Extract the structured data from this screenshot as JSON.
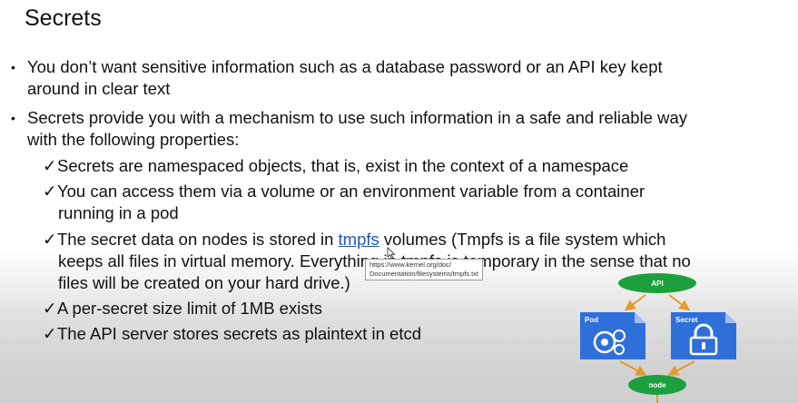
{
  "slide": {
    "title": "Secrets",
    "bullets": [
      {
        "dot": "•",
        "lines": [
          "You don’t want sensitive information such as a database password or an API key kept",
          "around in clear text"
        ]
      },
      {
        "dot": "•",
        "lines": [
          "Secrets provide you with a mechanism to use such information in a safe and reliable way",
          "with the following properties:"
        ]
      }
    ],
    "checks": {
      "mark": "✓",
      "items": [
        {
          "line1": "Secrets are namespaced objects, that is, exist in the context of a namespace"
        },
        {
          "line1": "You can access them via a volume or an environment variable from a container",
          "line2": "running in a pod"
        },
        {
          "line1_pre": "The secret data on nodes is stored in ",
          "link": "tmpfs",
          "line1_post": " volumes (Tmpfs is a file system which",
          "line2": "keeps all files in virtual memory. Everything in tmpfs is temporary in the sense that no",
          "line3": "files will be created on your hard drive.)"
        },
        {
          "line1": "A per-secret size limit of 1MB exists"
        },
        {
          "line1": "The API server stores secrets as plaintext in etcd"
        }
      ]
    },
    "tooltip": {
      "line1": "https://www.kernel.org/doc/",
      "line2": "Documentation/filesystems/tmpfs.txt"
    },
    "diagram": {
      "api_label": "API",
      "pod_label": "Pod",
      "secret_label": "Secret",
      "node_label": "node"
    }
  }
}
